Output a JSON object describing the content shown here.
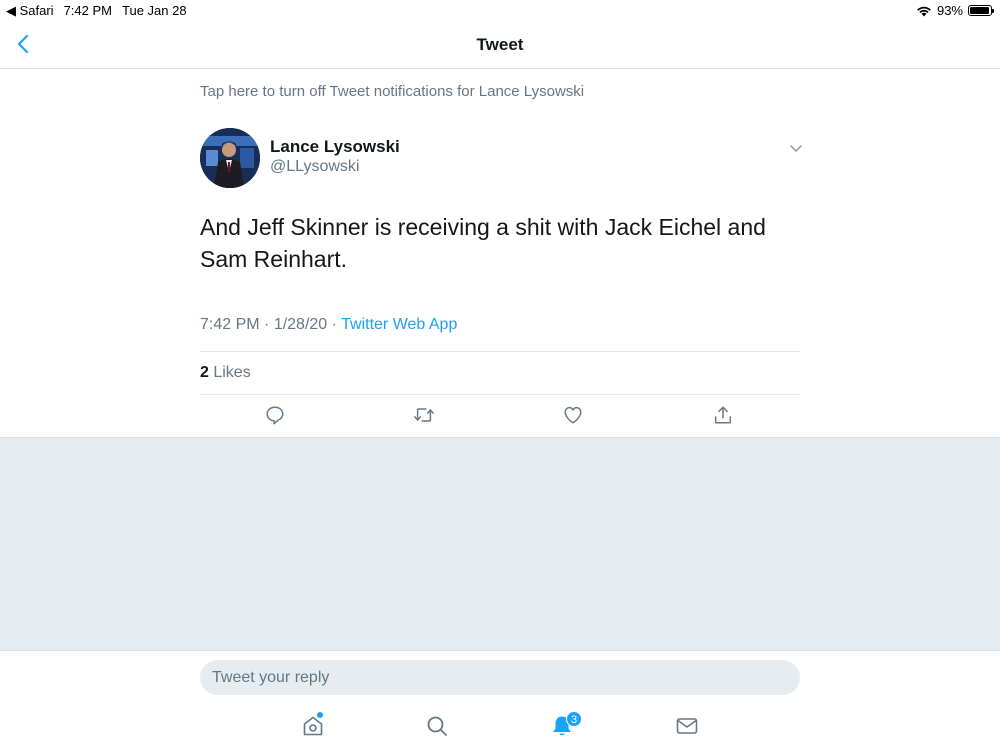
{
  "status_bar": {
    "app": "◀ Safari",
    "time": "7:42 PM",
    "date": "Tue Jan 28",
    "battery": "93%",
    "battery_level": 0.93
  },
  "nav": {
    "title": "Tweet",
    "back_icon": "chevron-left-icon"
  },
  "tweet": {
    "notification_text": "Tap here to turn off Tweet notifications for Lance Lysowski",
    "author_name": "Lance Lysowski",
    "author_handle": "@LLysowski",
    "text": "And Jeff Skinner is receiving a shit with Jack Eichel and Sam Reinhart.",
    "time": "7:42 PM",
    "date": "1/28/20",
    "separator": " · ",
    "source": "Twitter Web App",
    "likes_count": "2",
    "likes_label": " Likes"
  },
  "actions": [
    "reply-icon",
    "retweet-icon",
    "like-icon",
    "share-icon"
  ],
  "reply": {
    "placeholder": "Tweet your reply"
  },
  "tabbar": {
    "notification_badge": "3"
  },
  "colors": {
    "accent": "#1da1f2",
    "secondary_text": "#657786",
    "background_gray": "#e6ecf0"
  }
}
